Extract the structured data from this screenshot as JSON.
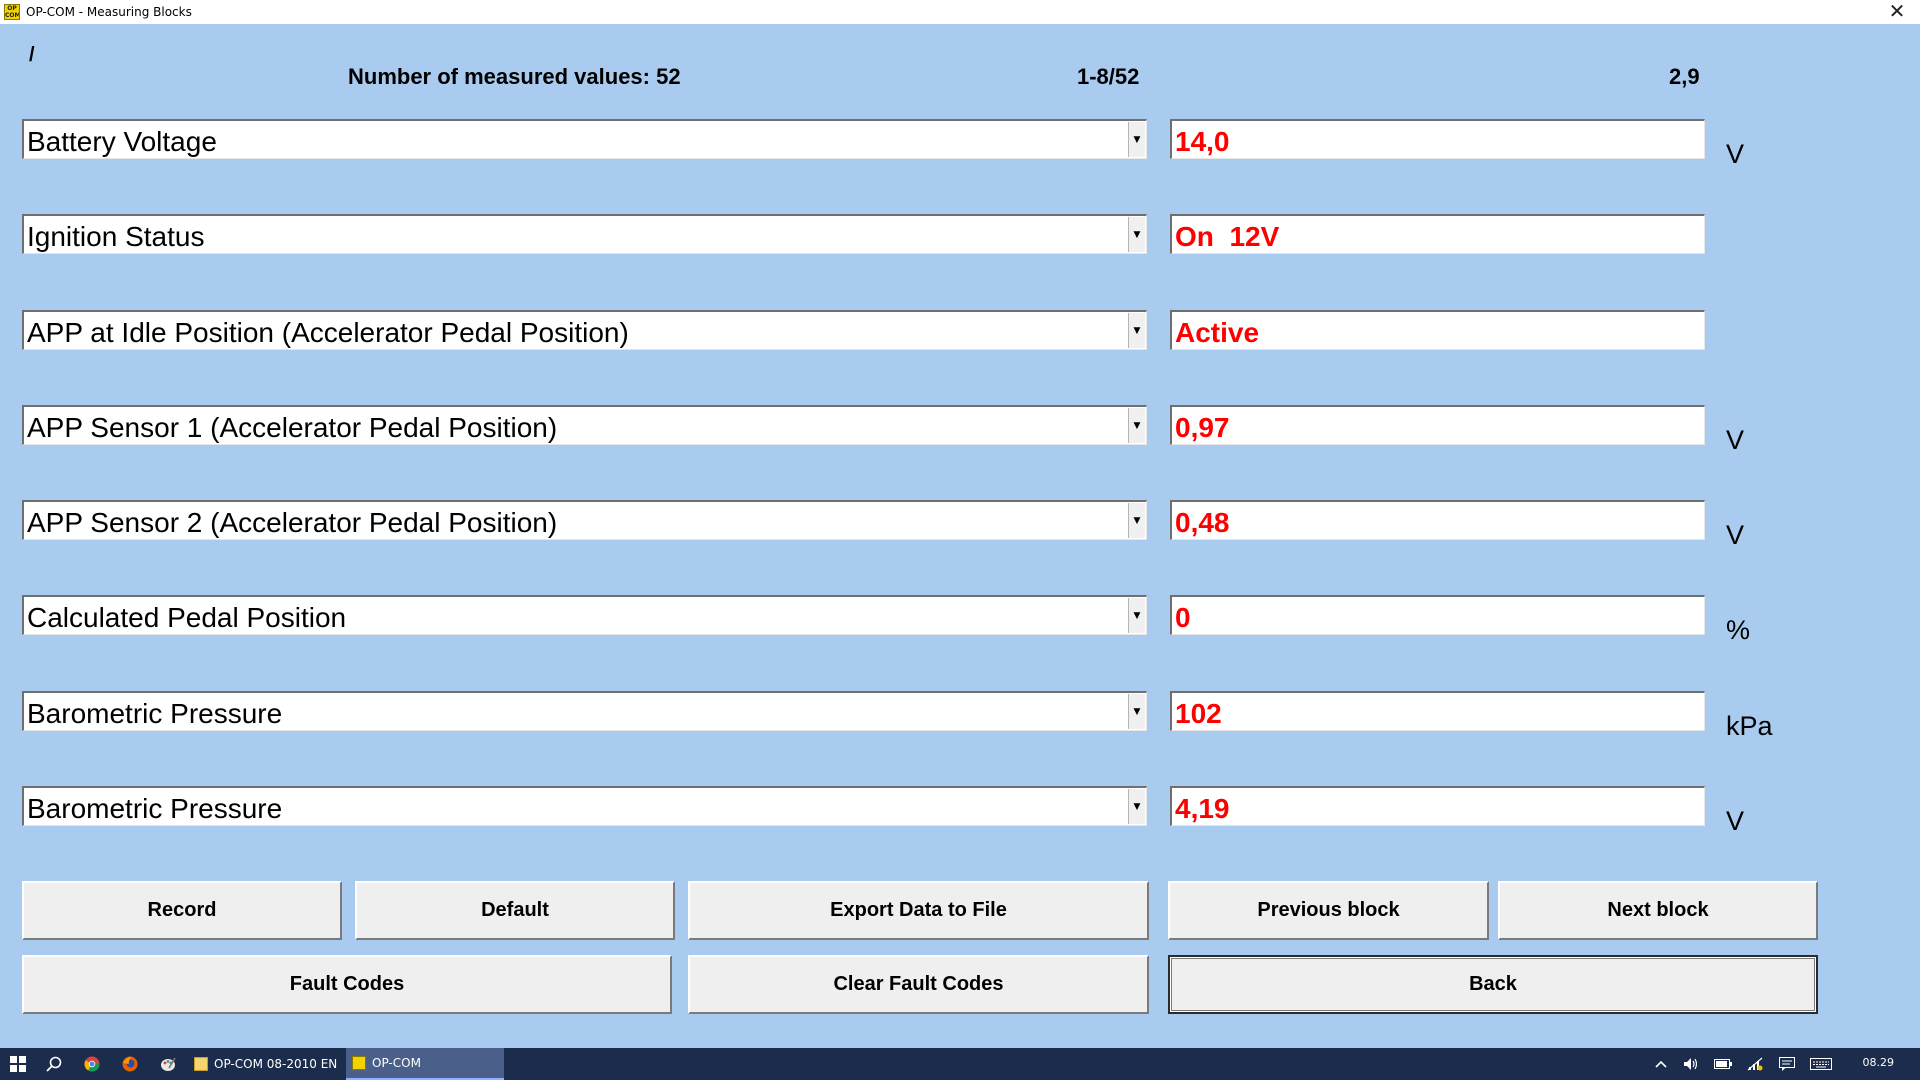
{
  "window": {
    "title": "OP-COM - Measuring Blocks",
    "close_symbol": "✕",
    "app_icon_text": "OP COM"
  },
  "header": {
    "slash": "/",
    "count_label": "Number of measured values: 52",
    "range": "1-8/52",
    "time": "2,9"
  },
  "measurements": [
    {
      "name": "Battery Voltage",
      "value": "14,0",
      "unit": "V"
    },
    {
      "name": "Ignition Status",
      "value": "On  12V",
      "unit": ""
    },
    {
      "name": "APP at Idle Position (Accelerator Pedal Position)",
      "value": "Active",
      "unit": ""
    },
    {
      "name": "APP Sensor 1 (Accelerator Pedal Position)",
      "value": "0,97",
      "unit": "V"
    },
    {
      "name": "APP Sensor 2 (Accelerator Pedal Position)",
      "value": "0,48",
      "unit": "V"
    },
    {
      "name": "Calculated Pedal Position",
      "value": "0",
      "unit": "%"
    },
    {
      "name": "Barometric Pressure",
      "value": "102",
      "unit": "kPa"
    },
    {
      "name": "Barometric Pressure",
      "value": "4,19",
      "unit": "V"
    }
  ],
  "dropdown_arrow": "▼",
  "buttons": {
    "record": "Record",
    "default": "Default",
    "export": "Export Data to File",
    "previous": "Previous block",
    "next": "Next block",
    "fault_codes": "Fault Codes",
    "clear_fault_codes": "Clear Fault Codes",
    "back": "Back"
  },
  "taskbar": {
    "task1_label": "OP-COM 08-2010 EN",
    "task2_label": "OP-COM",
    "clock": "08.29",
    "icons": [
      "windows-start-icon",
      "search-icon",
      "chrome-icon",
      "firefox-icon",
      "paint-icon"
    ],
    "tray_icons": [
      "chevron-up-icon",
      "speaker-icon",
      "battery-icon",
      "network-icon",
      "notification-icon",
      "keyboard-icon"
    ]
  },
  "colors": {
    "background": "#a9cbef",
    "value_text": "#ff0000",
    "taskbar": "#1c2c4c"
  }
}
